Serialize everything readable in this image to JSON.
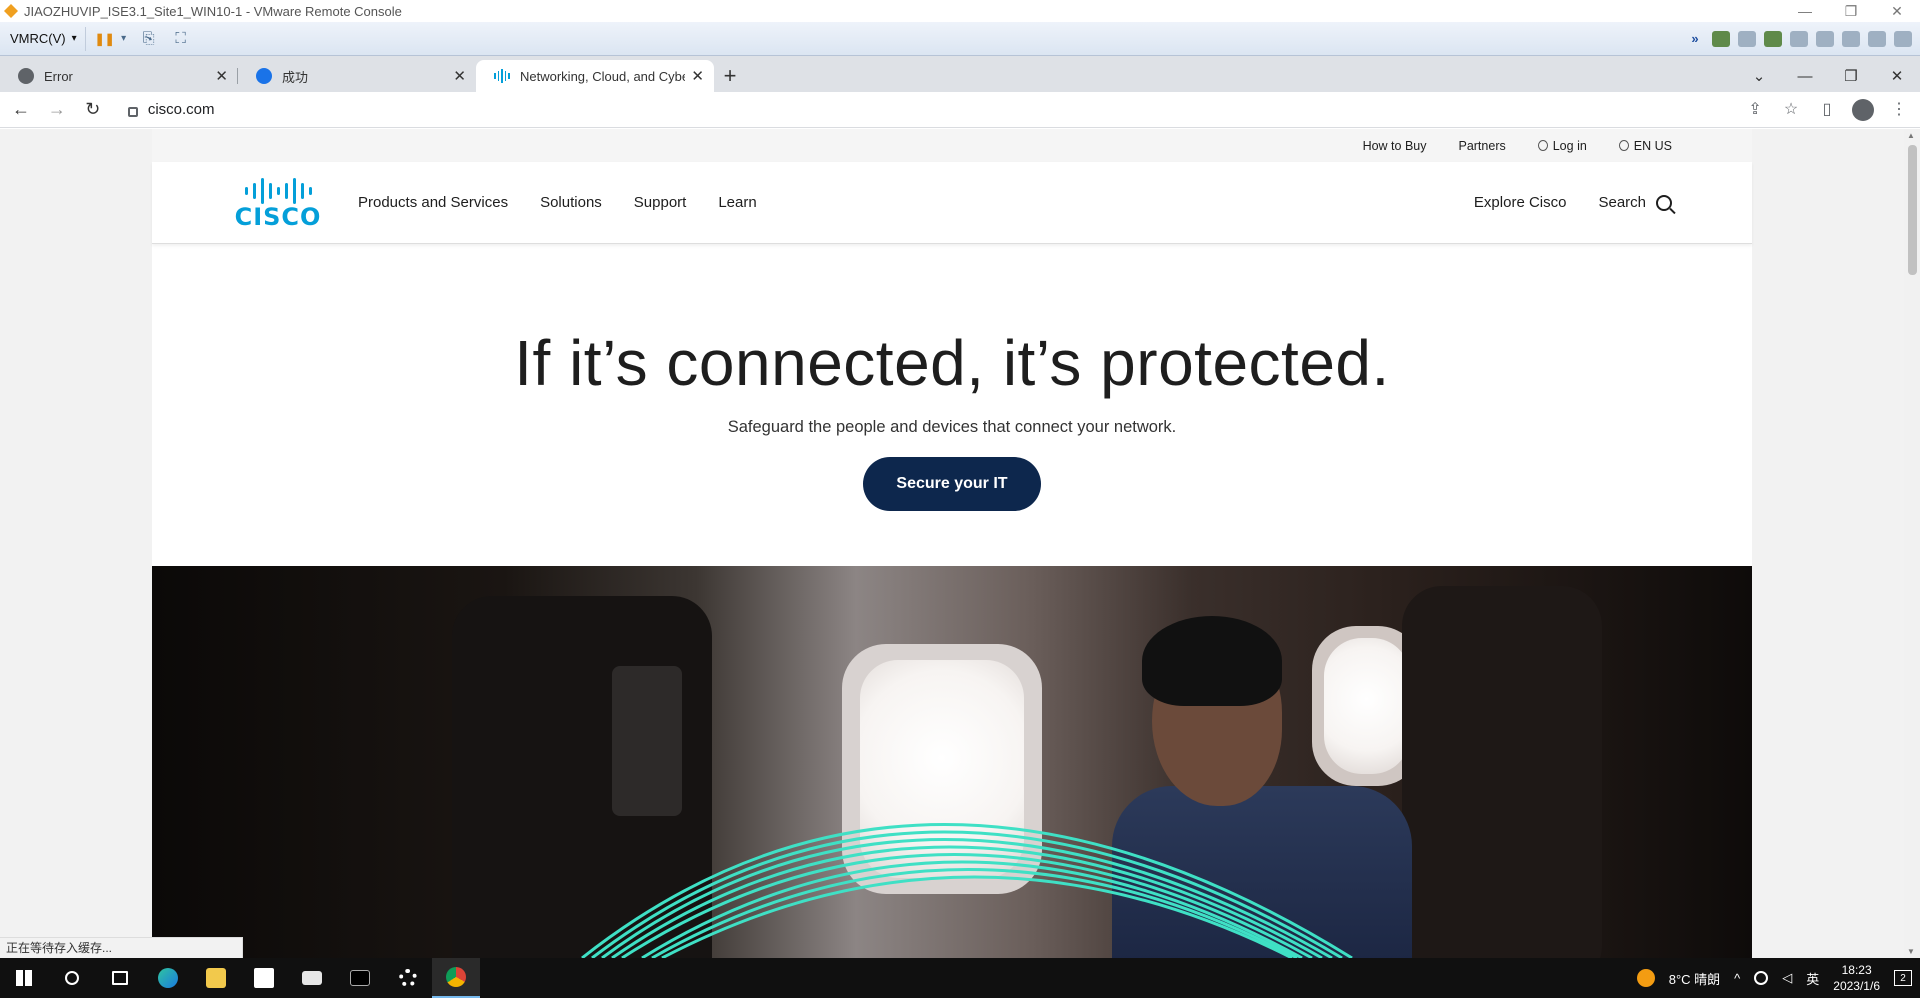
{
  "window": {
    "title": "JIAOZHUVIP_ISE3.1_Site1_WIN10-1 - VMware Remote Console",
    "minimize": "—",
    "restore": "❐",
    "close": "✕"
  },
  "vmrc": {
    "menu_label": "VMRC(V)",
    "menu_caret": "▾",
    "pause_glyph": "❚❚",
    "pause_caret": "▾",
    "send_keys_glyph": "⎘",
    "fullscreen_glyph": "⛶",
    "devices_arrow": "»"
  },
  "browser": {
    "tabs": [
      {
        "label": "Error",
        "favicon_color": "#5f6368",
        "close": "✕"
      },
      {
        "label": "成功",
        "favicon_color": "#1a73e8",
        "close": "✕"
      },
      {
        "label": "Networking, Cloud, and Cyber",
        "favicon_color": "#049fd9",
        "close": "✕"
      }
    ],
    "new_tab": "+",
    "tab_search": "⌄",
    "minimize": "—",
    "restore": "❐",
    "close": "✕",
    "back": "←",
    "forward": "→",
    "reload": "↻",
    "url": "cisco.com",
    "share": "⇪",
    "bookmark": "☆",
    "side_panel": "▯",
    "menu": "⋮",
    "status_text": "正在等待存入缓存..."
  },
  "site": {
    "utility": {
      "how_to_buy": "How to Buy",
      "partners": "Partners",
      "login": "Log in",
      "locale": "EN US"
    },
    "logo_text": "CISCO",
    "nav": [
      "Products and Services",
      "Solutions",
      "Support",
      "Learn"
    ],
    "explore": "Explore Cisco",
    "search": "Search",
    "hero": {
      "headline": "If it’s connected, it’s protected.",
      "subheadline": "Safeguard the people and devices that connect your network.",
      "cta": "Secure your IT"
    },
    "colors": {
      "brand_blue": "#049fd9",
      "cta_navy": "#0d274d",
      "arc_teal": "#3fe0c5"
    }
  },
  "taskbar": {
    "weather": "8°C 晴朗",
    "ime": "英",
    "time": "18:23",
    "date": "2023/1/6",
    "notifications": "2",
    "tray_caret": "^"
  }
}
